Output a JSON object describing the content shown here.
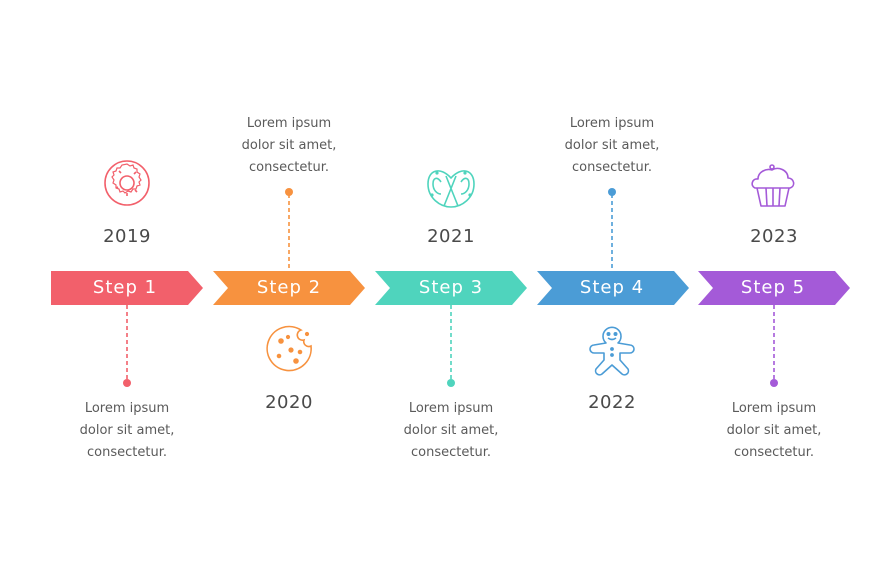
{
  "steps": [
    {
      "label": "Step 1",
      "year": "2019",
      "desc": [
        "Lorem ipsum",
        "dolor sit amet,",
        "consectetur."
      ],
      "color": "#f2606b",
      "icon": "donut-icon"
    },
    {
      "label": "Step 2",
      "year": "2020",
      "desc": [
        "Lorem ipsum",
        "dolor sit amet,",
        "consectetur."
      ],
      "color": "#f7923f",
      "icon": "cookie-icon"
    },
    {
      "label": "Step 3",
      "year": "2021",
      "desc": [
        "Lorem ipsum",
        "dolor sit amet,",
        "consectetur."
      ],
      "color": "#4fd4bd",
      "icon": "pretzel-icon"
    },
    {
      "label": "Step 4",
      "year": "2022",
      "desc": [
        "Lorem ipsum",
        "dolor sit amet,",
        "consectetur."
      ],
      "color": "#4b9cd6",
      "icon": "gingerbread-icon"
    },
    {
      "label": "Step 5",
      "year": "2023",
      "desc": [
        "Lorem ipsum",
        "dolor sit amet,",
        "consectetur."
      ],
      "color": "#a45ad8",
      "icon": "cupcake-icon"
    }
  ]
}
